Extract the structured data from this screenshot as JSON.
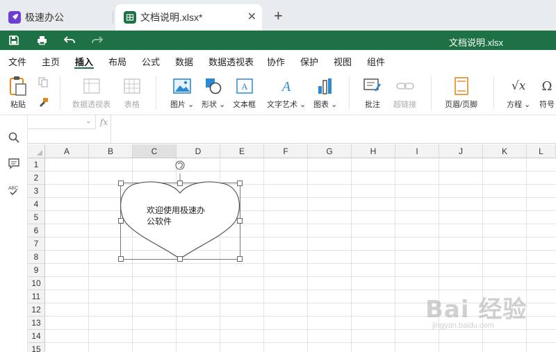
{
  "tabs": [
    {
      "label": "极速办公",
      "icon": "rocket-icon",
      "icon_color": "#6a3fd1"
    },
    {
      "label": "文档说明.xlsx*",
      "icon": "spreadsheet-icon",
      "icon_color": "#1e7145"
    }
  ],
  "quickbar": {
    "title": "文档说明.xlsx",
    "color": "#1e7145"
  },
  "menu": [
    "文件",
    "主页",
    "插入",
    "布局",
    "公式",
    "数据",
    "数据透视表",
    "协作",
    "保护",
    "视图",
    "组件"
  ],
  "menu_active": "插入",
  "ribbon": {
    "paste": "粘贴",
    "pivot_table": "数据透视表",
    "table": "表格",
    "picture": "图片",
    "shape": "形状",
    "textbox": "文本框",
    "text_art": "文字艺术",
    "chart": "图表",
    "comment": "批注",
    "hyperlink": "超链接",
    "header_footer": "页眉/页脚",
    "equation": "方程",
    "symbol": "符号"
  },
  "formula_bar": {
    "name_box": "",
    "fx_label": "fx",
    "value": ""
  },
  "grid": {
    "columns": [
      "A",
      "B",
      "C",
      "D",
      "E",
      "F",
      "G",
      "H",
      "I",
      "J",
      "K",
      "L"
    ],
    "selected_column": "C",
    "rows": [
      "1",
      "2",
      "3",
      "4",
      "5",
      "6",
      "7",
      "8",
      "9",
      "10",
      "11",
      "12",
      "13",
      "14",
      "15"
    ]
  },
  "shape": {
    "type": "heart",
    "text_line1": "欢迎使用极速办",
    "text_line2": "公软件"
  },
  "watermark": {
    "main": "Bai 经验",
    "sub": "jingyan.baidu.com"
  }
}
